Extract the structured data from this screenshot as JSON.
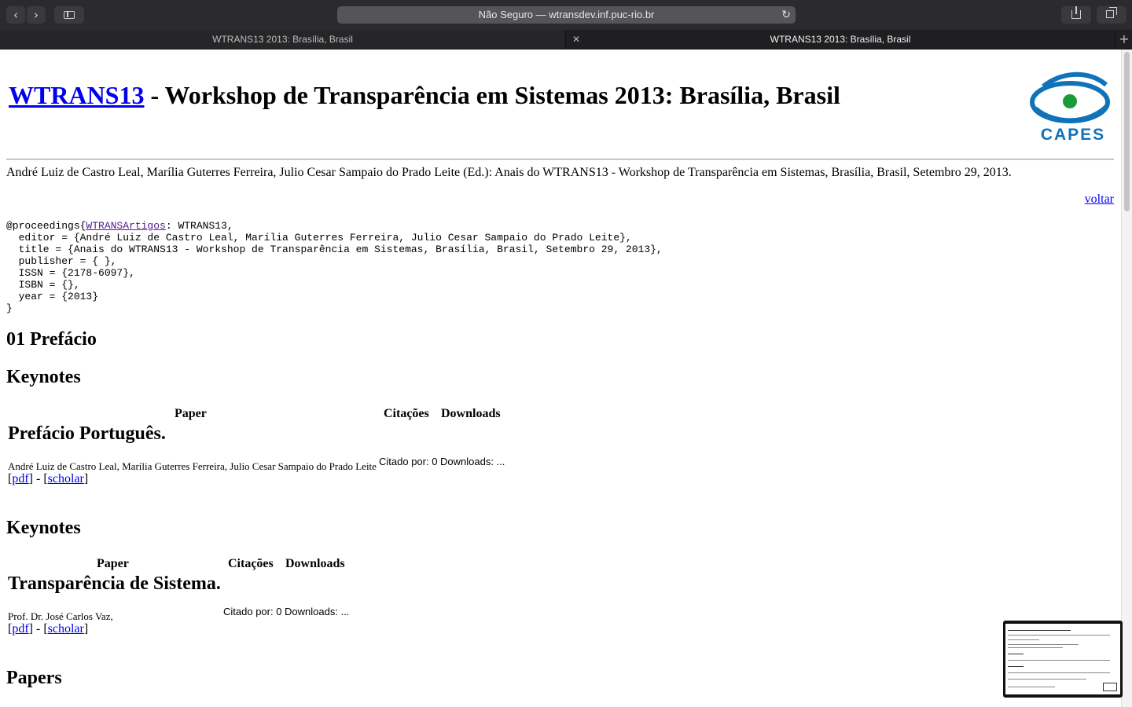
{
  "browser": {
    "address_text": "Não Seguro — wtransdev.inf.puc-rio.br",
    "tabs": [
      {
        "label": "WTRANS13 2013: Brasília, Brasil"
      },
      {
        "label": "WTRANS13 2013: Brasília, Brasil"
      }
    ]
  },
  "header": {
    "title_link": "WTRANS13",
    "title_rest": " - Workshop de Transparência em Sistemas 2013: Brasília, Brasil",
    "logo_text": "CAPES"
  },
  "citation": "André Luiz de Castro Leal, Marília Guterres Ferreira, Julio Cesar Sampaio do Prado Leite (Ed.): Anais do WTRANS13 - Workshop de Transparência em Sistemas, Brasília, Brasil, Setembro 29, 2013.",
  "voltar": "voltar",
  "bibtex": {
    "prefix": "@proceedings{",
    "key_link": "WTRANSArtigos",
    "rest": ": WTRANS13,\n  editor = {André Luiz de Castro Leal, Marília Guterres Ferreira, Julio Cesar Sampaio do Prado Leite},\n  title = {Anais do WTRANS13 - Workshop de Transparência em Sistemas, Brasília, Brasil, Setembro 29, 2013},\n  publisher = { },\n  ISSN = {2178-6097},\n  ISBN = {},\n  year = {2013}\n}"
  },
  "sections": {
    "prefacio": "01 Prefácio",
    "keynotes_1": "Keynotes",
    "keynotes_2": "Keynotes",
    "papers": "Papers"
  },
  "table_headers": {
    "paper": "Paper",
    "citacoes": "Citações",
    "downloads": "Downloads"
  },
  "entries": [
    {
      "title": "Prefácio Português.",
      "authors": "André Luiz de Castro Leal, Marília Guterres Ferreira, Julio Cesar Sampaio do Prado Leite",
      "stats": "Citado por: 0 Downloads: ...",
      "pdf": "pdf",
      "scholar": "scholar",
      "sep": "] - ["
    },
    {
      "title": "Transparência de Sistema.",
      "authors": "Prof. Dr. José Carlos Vaz,",
      "stats": "Citado por: 0 Downloads: ...",
      "pdf": "pdf",
      "scholar": "scholar",
      "sep": "] - ["
    }
  ]
}
